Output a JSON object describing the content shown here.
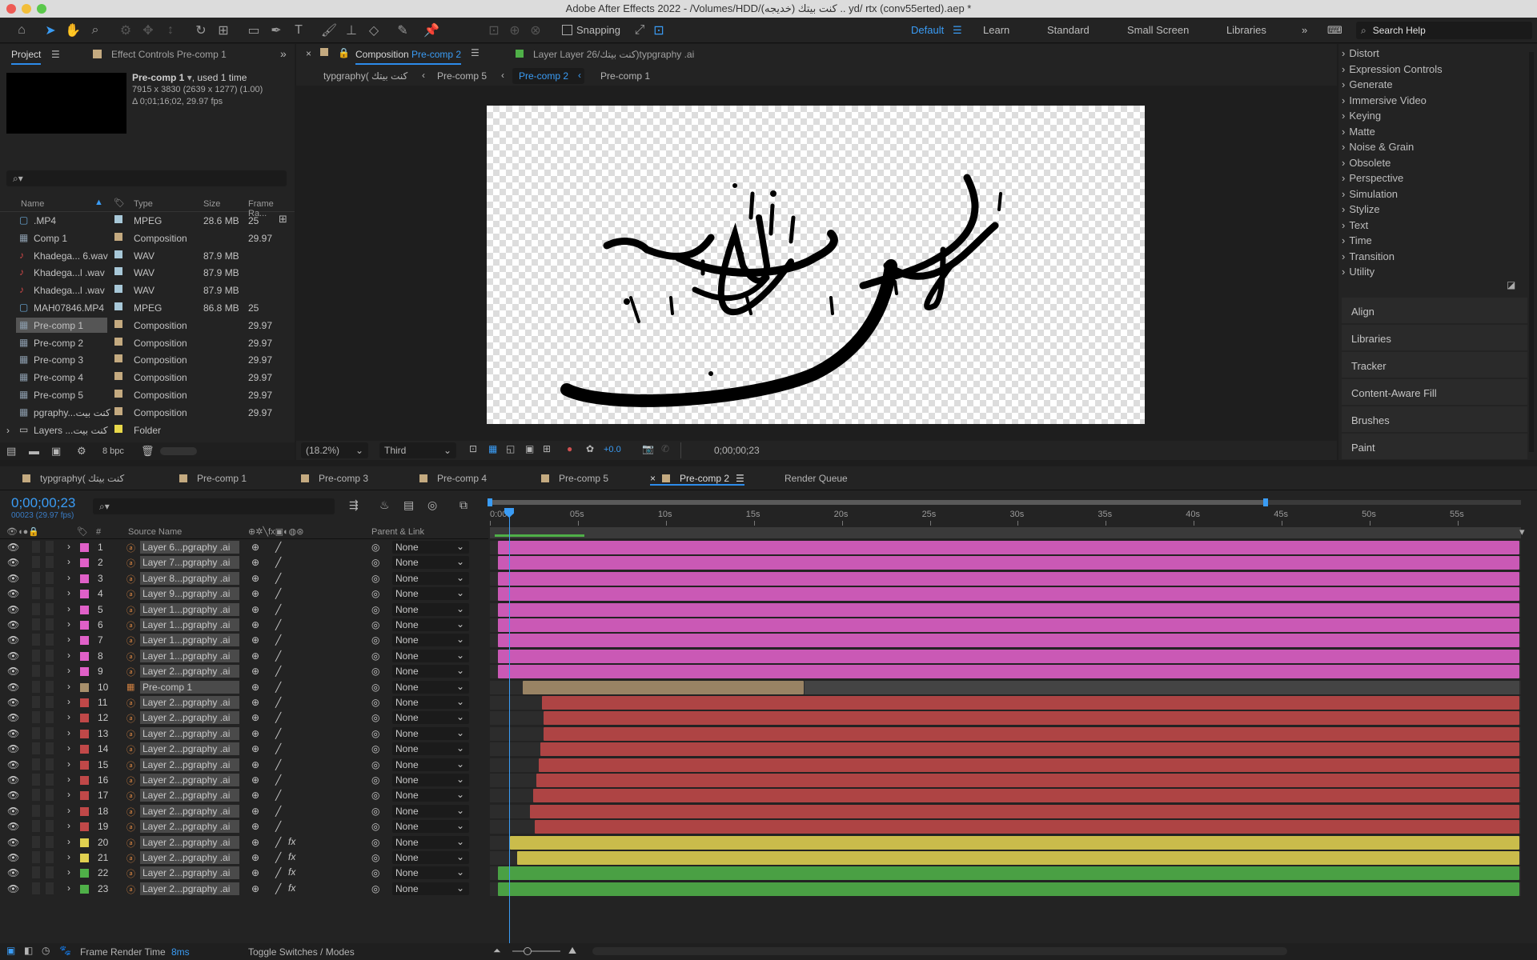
{
  "window": {
    "title": "Adobe After Effects 2022 - /Volumes/HDD/(خديجه) كنت بيتك .. yd/ rtx (conv55erted).aep *"
  },
  "toolbar": {
    "snapping": "Snapping",
    "workspaces": [
      "Default",
      "Learn",
      "Standard",
      "Small Screen",
      "Libraries"
    ],
    "search_placeholder": "Search Help"
  },
  "project": {
    "tab": "Project",
    "effect_tab": "Effect Controls Pre-comp 1",
    "info_name": "Pre-comp 1",
    "info_used": ", used 1 time",
    "info_dims": "7915 x 3830  (2639 x 1277) (1.00)",
    "info_dur": "Δ 0;01;16;02, 29.97 fps",
    "headers": {
      "name": "Name",
      "type": "Type",
      "size": "Size",
      "frame": "Frame Ra..."
    },
    "items": [
      {
        "name": ".MP4",
        "type": "MPEG",
        "size": "28.6 MB",
        "frame": "25",
        "swatch": "#a8c8d8",
        "kind": "video"
      },
      {
        "name": "Comp 1",
        "type": "Composition",
        "size": "",
        "frame": "29.97",
        "swatch": "#c4aa80",
        "kind": "comp"
      },
      {
        "name": "Khadega... 6.wav",
        "type": "WAV",
        "size": "87.9 MB",
        "frame": "",
        "swatch": "#a8c8d8",
        "kind": "audio"
      },
      {
        "name": "Khadega...l .wav",
        "type": "WAV",
        "size": "87.9 MB",
        "frame": "",
        "swatch": "#a8c8d8",
        "kind": "audio"
      },
      {
        "name": "Khadega...l .wav",
        "type": "WAV",
        "size": "87.9 MB",
        "frame": "",
        "swatch": "#a8c8d8",
        "kind": "audio"
      },
      {
        "name": "MAH07846.MP4",
        "type": "MPEG",
        "size": "86.8 MB",
        "frame": "25",
        "swatch": "#a8c8d8",
        "kind": "video"
      },
      {
        "name": "Pre-comp 1",
        "type": "Composition",
        "size": "",
        "frame": "29.97",
        "swatch": "#c4aa80",
        "kind": "comp",
        "selected": true
      },
      {
        "name": "Pre-comp 2",
        "type": "Composition",
        "size": "",
        "frame": "29.97",
        "swatch": "#c4aa80",
        "kind": "comp"
      },
      {
        "name": "Pre-comp 3",
        "type": "Composition",
        "size": "",
        "frame": "29.97",
        "swatch": "#c4aa80",
        "kind": "comp"
      },
      {
        "name": "Pre-comp 4",
        "type": "Composition",
        "size": "",
        "frame": "29.97",
        "swatch": "#c4aa80",
        "kind": "comp"
      },
      {
        "name": "Pre-comp 5",
        "type": "Composition",
        "size": "",
        "frame": "29.97",
        "swatch": "#c4aa80",
        "kind": "comp"
      },
      {
        "name": "pgraphy...كنت بيت",
        "type": "Composition",
        "size": "",
        "frame": "29.97",
        "swatch": "#c4aa80",
        "kind": "comp"
      },
      {
        "name": "Layers ...كنت بيت",
        "type": "Folder",
        "size": "",
        "frame": "",
        "swatch": "#e8d84a",
        "kind": "folder"
      }
    ],
    "bpc": "8 bpc"
  },
  "comp": {
    "tab": "Composition",
    "tab_name": "Pre-comp 2",
    "layer_tab": "Layer Layer 26/كنت بيتك)typgraphy .ai",
    "breadcrumbs": [
      "typgraphy( كنت بيتك",
      "Pre-comp 5",
      "Pre-comp 2",
      "Pre-comp 1"
    ],
    "zoom": "(18.2%)",
    "view": "Third",
    "exposure": "+0.0",
    "timecode": "0;00;00;23"
  },
  "effects": [
    "Distort",
    "Expression Controls",
    "Generate",
    "Immersive Video",
    "Keying",
    "Matte",
    "Noise & Grain",
    "Obsolete",
    "Perspective",
    "Simulation",
    "Stylize",
    "Text",
    "Time",
    "Transition",
    "Utility"
  ],
  "side_panels": [
    "Align",
    "Libraries",
    "Tracker",
    "Content-Aware Fill",
    "Brushes",
    "Paint"
  ],
  "timeline": {
    "tabs": [
      "typgraphy( كنت بيتك",
      "Pre-comp 1",
      "Pre-comp 3",
      "Pre-comp 4",
      "Pre-comp 5",
      "Pre-comp 2",
      "Render Queue"
    ],
    "timecode": "0;00;00;23",
    "frames": "00023 (29.97 fps)",
    "ruler": [
      "0:00s",
      "05s",
      "10s",
      "15s",
      "20s",
      "25s",
      "30s",
      "35s",
      "40s",
      "45s",
      "50s",
      "55s"
    ],
    "col_source": "Source Name",
    "col_parent": "Parent & Link",
    "col_hash": "#",
    "layers": [
      {
        "n": "1",
        "name": "Layer 6...pgraphy .ai",
        "color": "#e060c8",
        "start": 0,
        "fx": false
      },
      {
        "n": "2",
        "name": "Layer 7...pgraphy .ai",
        "color": "#e060c8",
        "start": 0,
        "fx": false
      },
      {
        "n": "3",
        "name": "Layer 8...pgraphy .ai",
        "color": "#e060c8",
        "start": 0,
        "fx": false
      },
      {
        "n": "4",
        "name": "Layer 9...pgraphy .ai",
        "color": "#e060c8",
        "start": 0,
        "fx": false
      },
      {
        "n": "5",
        "name": "Layer 1...pgraphy .ai",
        "color": "#e060c8",
        "start": 0,
        "fx": false
      },
      {
        "n": "6",
        "name": "Layer 1...pgraphy .ai",
        "color": "#e060c8",
        "start": 0,
        "fx": false
      },
      {
        "n": "7",
        "name": "Layer 1...pgraphy .ai",
        "color": "#e060c8",
        "start": 0,
        "fx": false
      },
      {
        "n": "8",
        "name": "Layer 1...pgraphy .ai",
        "color": "#e060c8",
        "start": 0,
        "fx": false
      },
      {
        "n": "9",
        "name": "Layer 2...pgraphy .ai",
        "color": "#e060c8",
        "start": 0,
        "fx": false
      },
      {
        "n": "10",
        "name": "Pre-comp 1",
        "color": "#a8906c",
        "start": 1.4,
        "end": 17.4,
        "fx": false,
        "comp": true
      },
      {
        "n": "11",
        "name": "Layer 2...pgraphy .ai",
        "color": "#c04848",
        "start": 2.5,
        "fx": false
      },
      {
        "n": "12",
        "name": "Layer 2...pgraphy .ai",
        "color": "#c04848",
        "start": 2.6,
        "fx": false
      },
      {
        "n": "13",
        "name": "Layer 2...pgraphy .ai",
        "color": "#c04848",
        "start": 2.6,
        "fx": false
      },
      {
        "n": "14",
        "name": "Layer 2...pgraphy .ai",
        "color": "#c04848",
        "start": 2.4,
        "fx": false
      },
      {
        "n": "15",
        "name": "Layer 2...pgraphy .ai",
        "color": "#c04848",
        "start": 2.3,
        "fx": false
      },
      {
        "n": "16",
        "name": "Layer 2...pgraphy .ai",
        "color": "#c04848",
        "start": 2.2,
        "fx": false
      },
      {
        "n": "17",
        "name": "Layer 2...pgraphy .ai",
        "color": "#c04848",
        "start": 2.0,
        "fx": false
      },
      {
        "n": "18",
        "name": "Layer 2...pgraphy .ai",
        "color": "#c04848",
        "start": 1.8,
        "fx": false
      },
      {
        "n": "19",
        "name": "Layer 2...pgraphy .ai",
        "color": "#c04848",
        "start": 2.1,
        "fx": false
      },
      {
        "n": "20",
        "name": "Layer 2...pgraphy .ai",
        "color": "#e0d050",
        "start": 0.7,
        "fx": true
      },
      {
        "n": "21",
        "name": "Layer 2...pgraphy .ai",
        "color": "#e0d050",
        "start": 1.1,
        "fx": true
      },
      {
        "n": "22",
        "name": "Layer 2...pgraphy .ai",
        "color": "#4fb048",
        "start": 0,
        "fx": true
      },
      {
        "n": "23",
        "name": "Layer 2...pgraphy .ai",
        "color": "#4fb048",
        "start": 0,
        "fx": true
      }
    ],
    "parent": "None",
    "render_time_label": "Frame Render Time",
    "render_time": "8ms",
    "toggle": "Toggle Switches / Modes"
  }
}
